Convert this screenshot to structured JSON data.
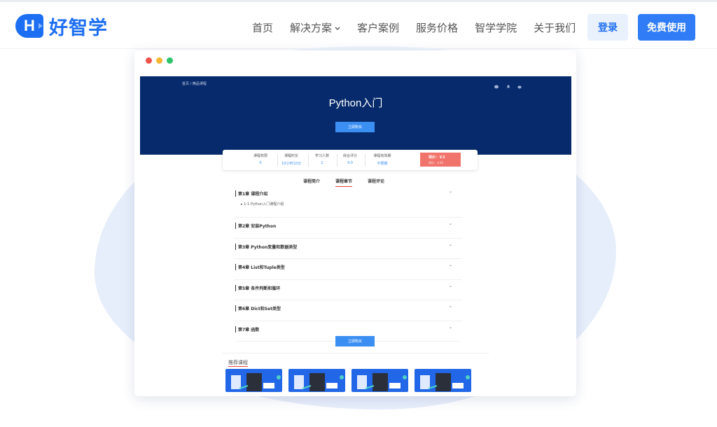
{
  "header": {
    "logo_letter": "H",
    "logo_text": "好智学",
    "nav": [
      {
        "label": "首页",
        "dropdown": false
      },
      {
        "label": "解决方案",
        "dropdown": true
      },
      {
        "label": "客户案例",
        "dropdown": false
      },
      {
        "label": "服务价格",
        "dropdown": false
      },
      {
        "label": "智学学院",
        "dropdown": false
      },
      {
        "label": "关于我们",
        "dropdown": false
      }
    ],
    "login_label": "登录",
    "free_label": "免费使用"
  },
  "mock": {
    "breadcrumb": "首页 / 精品课程",
    "title": "Python入门",
    "buy_label": "立即购买",
    "stats": [
      {
        "label": "课程权限",
        "value": "0"
      },
      {
        "label": "课程时长",
        "value": "10小时10分"
      },
      {
        "label": "学习人数",
        "value": "2"
      },
      {
        "label": "综合评分",
        "value": "9.0"
      },
      {
        "label": "课程有效期",
        "value": "不限期"
      }
    ],
    "price": {
      "current": "现价：￥2",
      "original": "原价：￥40"
    },
    "tabs": [
      "课程简介",
      "课程章节",
      "课程评论"
    ],
    "active_tab": 1,
    "chapters": [
      {
        "title": "第1章 课程介绍",
        "lessons": [
          "1-1 Python入门课程介绍"
        ]
      },
      {
        "title": "第2章 安装Python"
      },
      {
        "title": "第3章 Python变量和数据类型"
      },
      {
        "title": "第4章 List和Tuple类型"
      },
      {
        "title": "第5章 条件判断和循环"
      },
      {
        "title": "第6章 Dict和Set类型"
      },
      {
        "title": "第7章 函数"
      }
    ],
    "bottom_buy_label": "立即购买",
    "recommend_title": "推荐课程",
    "recommend_count": 4
  },
  "colors": {
    "brand": "#1c6ef2",
    "hero": "#062a6b",
    "price": "#f0746c"
  }
}
